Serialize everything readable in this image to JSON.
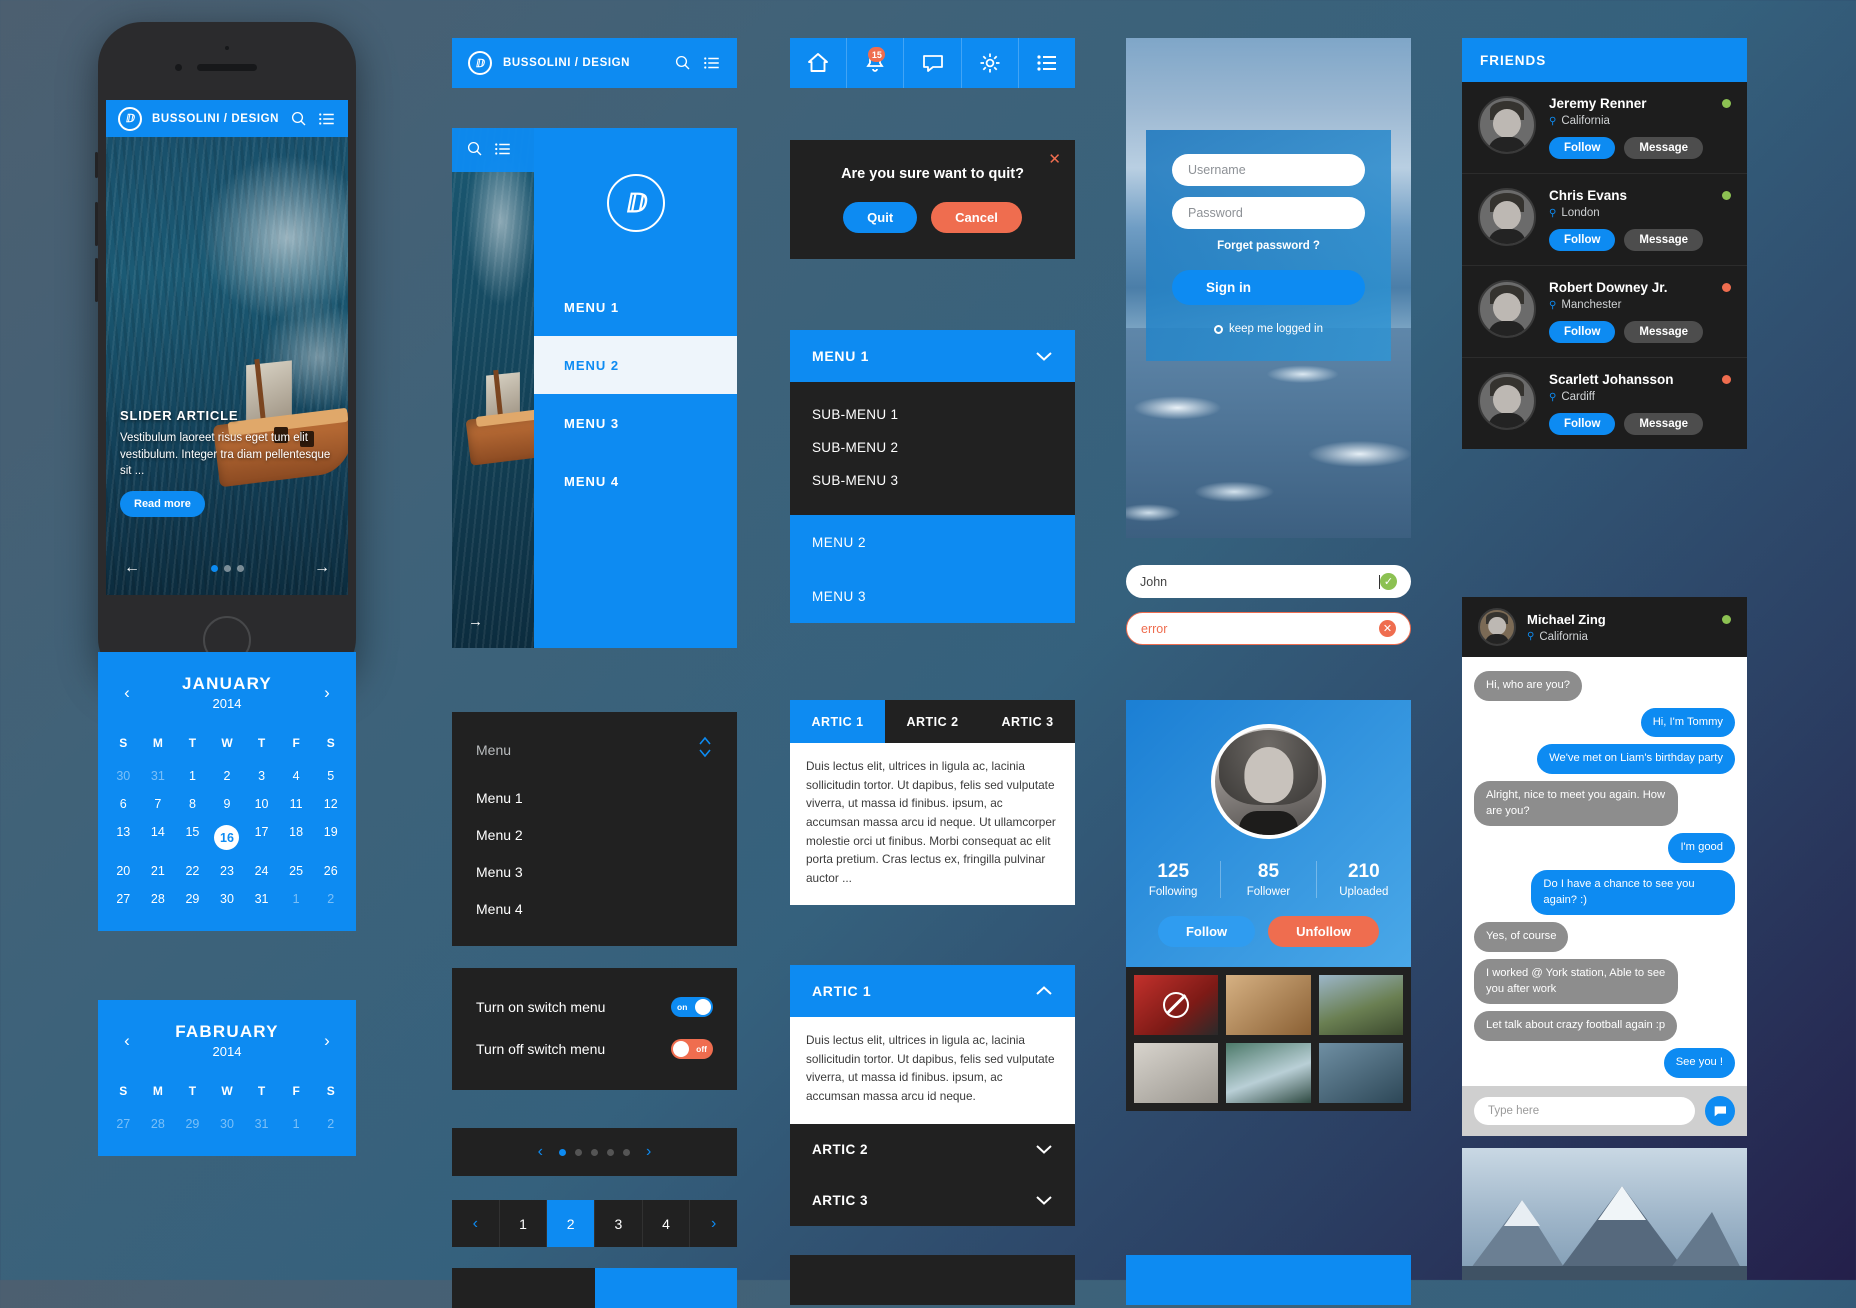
{
  "brand": {
    "name": "BUSSOLINI / DESIGN",
    "logo_glyph": "ⅅ",
    "accent": "#0d8bf2",
    "danger": "#ef6d4f",
    "dark": "#212121"
  },
  "phone": {
    "appbar_title": "BUSSOLINI / DESIGN",
    "search_icon": "search-icon",
    "menu_icon": "list-menu-icon",
    "slider": {
      "title": "SLIDER ARTICLE",
      "body": "Vestibulum laoreet risus eget tum elit vestibulum. Integer tra diam pellentesque sit ...",
      "read_more": "Read more",
      "prev": "←",
      "next": "→",
      "dots": 3,
      "active_dot": 1
    }
  },
  "calendar": {
    "prev": "‹",
    "next": "›",
    "dow": [
      "S",
      "M",
      "T",
      "W",
      "T",
      "F",
      "S"
    ],
    "january": {
      "month": "JANUARY",
      "year": "2014",
      "weeks": [
        [
          {
            "d": "30",
            "m": true
          },
          {
            "d": "31",
            "m": true
          },
          {
            "d": "1"
          },
          {
            "d": "2"
          },
          {
            "d": "3"
          },
          {
            "d": "4"
          },
          {
            "d": "5"
          }
        ],
        [
          {
            "d": "6"
          },
          {
            "d": "7"
          },
          {
            "d": "8"
          },
          {
            "d": "9"
          },
          {
            "d": "10"
          },
          {
            "d": "11"
          },
          {
            "d": "12"
          }
        ],
        [
          {
            "d": "13"
          },
          {
            "d": "14"
          },
          {
            "d": "15"
          },
          {
            "d": "16",
            "sel": true
          },
          {
            "d": "17"
          },
          {
            "d": "18"
          },
          {
            "d": "19"
          }
        ],
        [
          {
            "d": "20"
          },
          {
            "d": "21"
          },
          {
            "d": "22"
          },
          {
            "d": "23"
          },
          {
            "d": "24"
          },
          {
            "d": "25"
          },
          {
            "d": "26"
          }
        ],
        [
          {
            "d": "27"
          },
          {
            "d": "28"
          },
          {
            "d": "29"
          },
          {
            "d": "30"
          },
          {
            "d": "31"
          },
          {
            "d": "1",
            "m": true
          },
          {
            "d": "2",
            "m": true
          }
        ]
      ]
    },
    "february": {
      "month": "FABRUARY",
      "year": "2014",
      "weeks": [
        [
          {
            "d": "27",
            "m": true
          },
          {
            "d": "28",
            "m": true
          },
          {
            "d": "29",
            "m": true
          },
          {
            "d": "30",
            "m": true
          },
          {
            "d": "31",
            "m": true
          },
          {
            "d": "1",
            "m": true
          },
          {
            "d": "2",
            "m": true
          }
        ]
      ]
    }
  },
  "drawer": {
    "search_icon": "search-icon",
    "list_icon": "list-menu-icon",
    "items": [
      {
        "label": "MENU 1",
        "active": false
      },
      {
        "label": "MENU 2",
        "active": true
      },
      {
        "label": "MENU 3",
        "active": false
      },
      {
        "label": "MENU 4",
        "active": false
      }
    ],
    "peek_arrow": "→"
  },
  "menu_list": {
    "title": "Menu",
    "stepper_up": "up-chevron-icon",
    "stepper_down": "down-chevron-icon",
    "items": [
      "Menu 1",
      "Menu 2",
      "Menu 3",
      "Menu 4"
    ]
  },
  "switches": [
    {
      "label": "Turn on switch menu",
      "state": "on",
      "state_text": "on"
    },
    {
      "label": "Turn off switch menu",
      "state": "off",
      "state_text": "off"
    }
  ],
  "carousel": {
    "prev": "‹",
    "next": "›",
    "dots": 5,
    "active": 1
  },
  "pager": {
    "prev": "‹",
    "next": "›",
    "pages": [
      "1",
      "2",
      "3",
      "4"
    ],
    "active": "2"
  },
  "iconbar": [
    {
      "name": "home-icon",
      "badge": null
    },
    {
      "name": "bell-icon",
      "badge": "15"
    },
    {
      "name": "chat-icon",
      "badge": null
    },
    {
      "name": "gear-icon",
      "badge": null
    },
    {
      "name": "list-menu-icon",
      "badge": null
    }
  ],
  "quit_dialog": {
    "question": "Are you sure want to quit?",
    "confirm": "Quit",
    "cancel": "Cancel",
    "close_icon": "close-icon"
  },
  "accordion_menu": {
    "header": "MENU 1",
    "chevron": "chevron-down-icon",
    "subitems": [
      "SUB-MENU 1",
      "SUB-MENU 2",
      "SUB-MENU 3"
    ],
    "others": [
      "MENU 2",
      "MENU 3"
    ]
  },
  "tabs": {
    "items": [
      {
        "label": "ARTIC 1",
        "active": true
      },
      {
        "label": "ARTIC 2",
        "active": false
      },
      {
        "label": "ARTIC 3",
        "active": false
      }
    ],
    "body": "Duis lectus elit, ultrices in ligula ac, lacinia sollicitudin tortor. Ut dapibus, felis sed vulputate viverra, ut massa id finibus. ipsum, ac accumsan massa arcu id neque. Ut ullamcorper molestie orci ut finibus. Morbi consequat ac elit porta pretium. Cras lectus ex, fringilla pulvinar auctor ..."
  },
  "accordion_artic": {
    "open": {
      "label": "ARTIC 1",
      "chevron": "chevron-up-icon",
      "body": "Duis lectus elit, ultrices in ligula ac, lacinia sollicitudin tortor. Ut dapibus, felis sed vulputate viverra, ut massa id finibus. ipsum, ac accumsan massa arcu id neque."
    },
    "closed": [
      {
        "label": "ARTIC 2",
        "chevron": "chevron-down-icon"
      },
      {
        "label": "ARTIC 3",
        "chevron": "chevron-down-icon"
      }
    ]
  },
  "login": {
    "username_placeholder": "Username",
    "password_placeholder": "Password",
    "forgot": "Forget password ?",
    "sign_in": "Sign in",
    "keep_logged": "keep me logged in"
  },
  "validation": [
    {
      "value": "John",
      "state": "valid",
      "mark": "✓"
    },
    {
      "value": "error",
      "state": "error",
      "mark": "✕"
    }
  ],
  "profile": {
    "avatar": "user-avatar",
    "stats": [
      {
        "num": "125",
        "label": "Following"
      },
      {
        "num": "85",
        "label": "Follower"
      },
      {
        "num": "210",
        "label": "Uploaded"
      }
    ],
    "follow": "Follow",
    "unfollow": "Unfollow",
    "gallery": [
      {
        "name": "red-jacket-photo",
        "banned": true
      },
      {
        "name": "desk-notebook-photo",
        "banned": false
      },
      {
        "name": "horses-field-photo",
        "banned": false
      },
      {
        "name": "origami-photo",
        "banned": false
      },
      {
        "name": "waterfall-photo",
        "banned": false
      },
      {
        "name": "bay-rocks-photo",
        "banned": false
      }
    ]
  },
  "friends": {
    "title": "FRIENDS",
    "follow_label": "Follow",
    "message_label": "Message",
    "items": [
      {
        "name": "Jeremy Renner",
        "location": "California",
        "status": "#8cc152"
      },
      {
        "name": "Chris Evans",
        "location": "London",
        "status": "#8cc152"
      },
      {
        "name": "Robert Downey Jr.",
        "location": "Manchester",
        "status": "#ef6d4f"
      },
      {
        "name": "Scarlett Johansson",
        "location": "Cardiff",
        "status": "#ef6d4f"
      }
    ]
  },
  "chat": {
    "name": "Michael Zing",
    "location": "California",
    "status": "#8cc152",
    "messages": [
      {
        "from": "them",
        "text": "Hi, who are you?"
      },
      {
        "from": "me",
        "text": "Hi, I'm Tommy"
      },
      {
        "from": "me",
        "text": "We've met on Liam's birthday party"
      },
      {
        "from": "them",
        "text": "Alright, nice to meet you again. How are you?",
        "multi": true
      },
      {
        "from": "me",
        "text": "I'm good"
      },
      {
        "from": "me",
        "text": "Do I have a chance to see you again? :)",
        "multi": true
      },
      {
        "from": "them",
        "text": "Yes, of course"
      },
      {
        "from": "them",
        "text": "I worked @ York station, Able to see you after work",
        "multi": true
      },
      {
        "from": "them",
        "text": "Let talk about crazy football again :p"
      },
      {
        "from": "me",
        "text": "See you !"
      }
    ],
    "input_placeholder": "Type here",
    "send_icon": "chat-send-icon"
  }
}
